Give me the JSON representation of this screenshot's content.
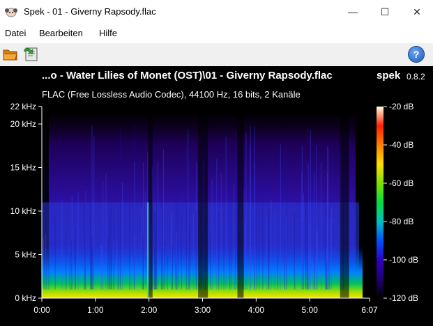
{
  "window": {
    "title": "Spek - 01 - Giverny Rapsody.flac",
    "minimize_glyph": "—",
    "maximize_glyph": "☐",
    "close_glyph": "✕"
  },
  "menu": {
    "items": [
      "Datei",
      "Bearbeiten",
      "Hilfe"
    ]
  },
  "toolbar": {
    "icons": [
      "open-folder-icon",
      "save-refresh-icon",
      "help-icon"
    ],
    "help_glyph": "?"
  },
  "spectrogram": {
    "title": "...o - Water Lilies of Monet (OST)\\01 - Giverny Rapsody.flac",
    "brand": "spek",
    "version": "0.8.2",
    "info": "FLAC (Free Lossless Audio Codec), 44100 Hz, 16 bits, 2 Kanäle",
    "y_ticks": [
      "22 kHz",
      "20 kHz",
      "15 kHz",
      "10 kHz",
      "5 kHz",
      "0 kHz"
    ],
    "y_values_khz": [
      22,
      20,
      15,
      10,
      5,
      0
    ],
    "x_ticks": [
      "0:00",
      "1:00",
      "2:00",
      "3:00",
      "4:00",
      "5:00",
      "6:07"
    ],
    "x_values_s": [
      0,
      60,
      120,
      180,
      240,
      300,
      367
    ],
    "db_ticks": [
      "-20 dB",
      "-40 dB",
      "-60 dB",
      "-80 dB",
      "-100 dB",
      "-120 dB"
    ],
    "db_values": [
      -20,
      -40,
      -60,
      -80,
      -100,
      -120
    ],
    "colors": {
      "background": "#000000",
      "text": "#ffffff",
      "scale_stops": [
        "#ffffe0",
        "#ff2000",
        "#ff8000",
        "#ffe000",
        "#80e000",
        "#00e040",
        "#00c0c0",
        "#0050ff",
        "#3000c0",
        "#200070",
        "#000000"
      ]
    }
  }
}
